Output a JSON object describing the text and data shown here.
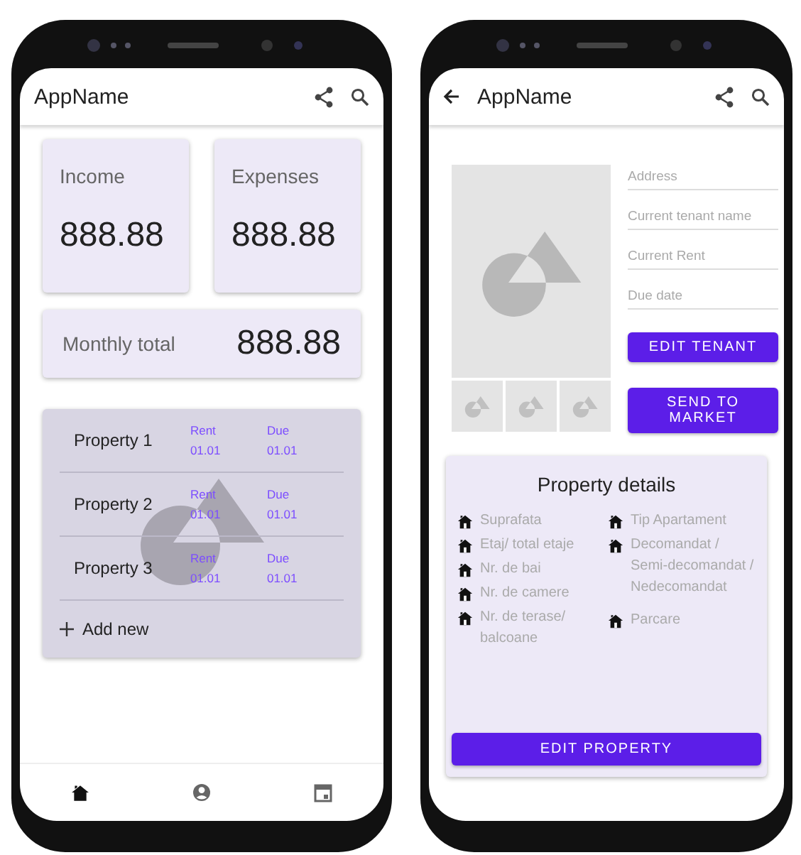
{
  "home_screen": {
    "app_bar": {
      "title": "AppName"
    },
    "summary_cards": [
      {
        "label": "Income",
        "value": "888.88"
      },
      {
        "label": "Expenses",
        "value": "888.88"
      }
    ],
    "monthly_total": {
      "label": "Monthly total",
      "value": "888.88"
    },
    "properties": [
      {
        "name": "Property 1",
        "rent_label": "Rent",
        "rent": "01.01",
        "due_label": "Due",
        "due": "01.01"
      },
      {
        "name": "Property 2",
        "rent_label": "Rent",
        "rent": "01.01",
        "due_label": "Due",
        "due": "01.01"
      },
      {
        "name": "Property 3",
        "rent_label": "Rent",
        "rent": "01.01",
        "due_label": "Due",
        "due": "01.01"
      }
    ],
    "add_new": "Add new",
    "bottom_nav": [
      {
        "kind": "home",
        "selected": true
      },
      {
        "kind": "account",
        "selected": false
      },
      {
        "kind": "calendar",
        "selected": false
      }
    ]
  },
  "property_screen": {
    "app_bar": {
      "title": "AppName"
    },
    "fields": [
      {
        "placeholder": "Address"
      },
      {
        "placeholder": "Current tenant name"
      },
      {
        "placeholder": "Current Rent"
      },
      {
        "placeholder": "Due date"
      }
    ],
    "buttons": [
      "EDIT TENANT",
      "SEND TO MARKET"
    ],
    "details": {
      "title": "Property details",
      "column_1": [
        "Suprafata",
        "Etaj/ total etaje",
        "Nr. de bai",
        "Nr. de camere",
        "Nr. de terase/ balcoane"
      ],
      "column_2": [
        "Tip Apartament",
        "Decomandat / Semi-decomandat / Nedecomandat",
        "Parcare"
      ],
      "button": "EDIT PROPERTY"
    }
  }
}
